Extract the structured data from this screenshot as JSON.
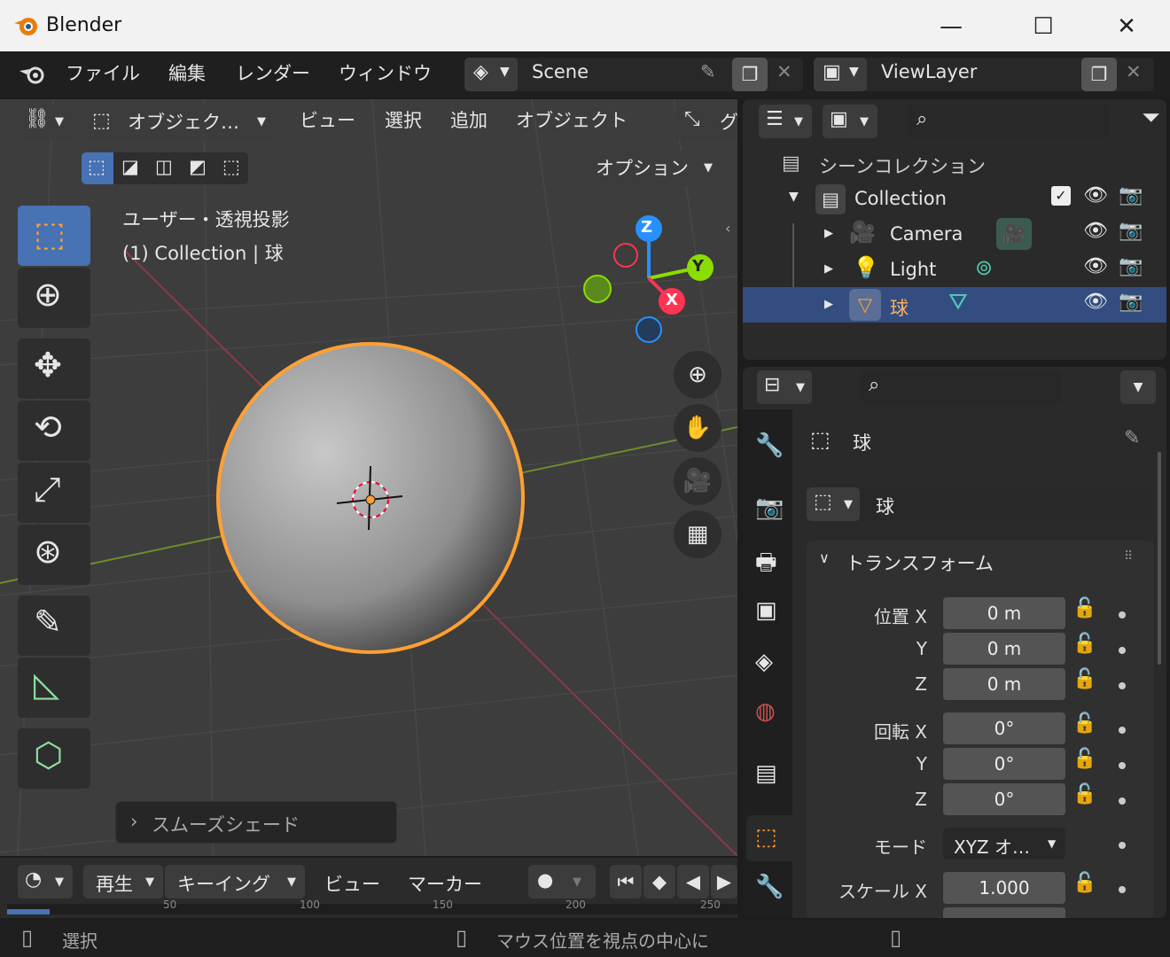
{
  "window": {
    "title": "Blender",
    "minimize": "—",
    "maximize": "☐",
    "close": "✕"
  },
  "topbar": {
    "menus": [
      "ファイル",
      "編集",
      "レンダー",
      "ウィンドウ"
    ],
    "scene": "Scene",
    "viewlayer": "ViewLayer"
  },
  "viewport": {
    "header": {
      "mode": "オブジェク…",
      "menus": [
        "ビュー",
        "選択",
        "追加",
        "オブジェクト"
      ],
      "trunc": "グ"
    },
    "options": "オプション",
    "overlay_title": "ユーザー・透視投影",
    "overlay_sub": "(1) Collection | 球",
    "axes": {
      "x": "X",
      "y": "Y",
      "z": "Z"
    },
    "last_op": "スムーズシェード",
    "colors": {
      "x": "#ff3352",
      "y": "#8bdc00",
      "z": "#2890ff",
      "selection": "#ffa033"
    }
  },
  "timeline": {
    "play": "再生",
    "keying": "キーイング",
    "view": "ビュー",
    "marker": "マーカー",
    "ticks": [
      "50",
      "100",
      "150",
      "200",
      "250"
    ]
  },
  "outliner": {
    "scene_collection": "シーンコレクション",
    "items": [
      {
        "name": "Collection"
      },
      {
        "name": "Camera"
      },
      {
        "name": "Light"
      },
      {
        "name": "球"
      }
    ]
  },
  "properties": {
    "object_name": "球",
    "datablock_name": "球",
    "panel": "トランスフォーム",
    "location": {
      "label": "位置 X",
      "x": "0 m",
      "y": "0 m",
      "z": "0 m"
    },
    "rotation": {
      "label": "回転 X",
      "x": "0°",
      "y": "0°",
      "z": "0°"
    },
    "axis_y": "Y",
    "axis_z": "Z",
    "mode_label": "モード",
    "mode_value": "XYZ オ…",
    "scale": {
      "label": "スケール X",
      "x": "1.000"
    }
  },
  "status": {
    "left": "選択",
    "middle": "マウス位置を視点の中心に"
  }
}
